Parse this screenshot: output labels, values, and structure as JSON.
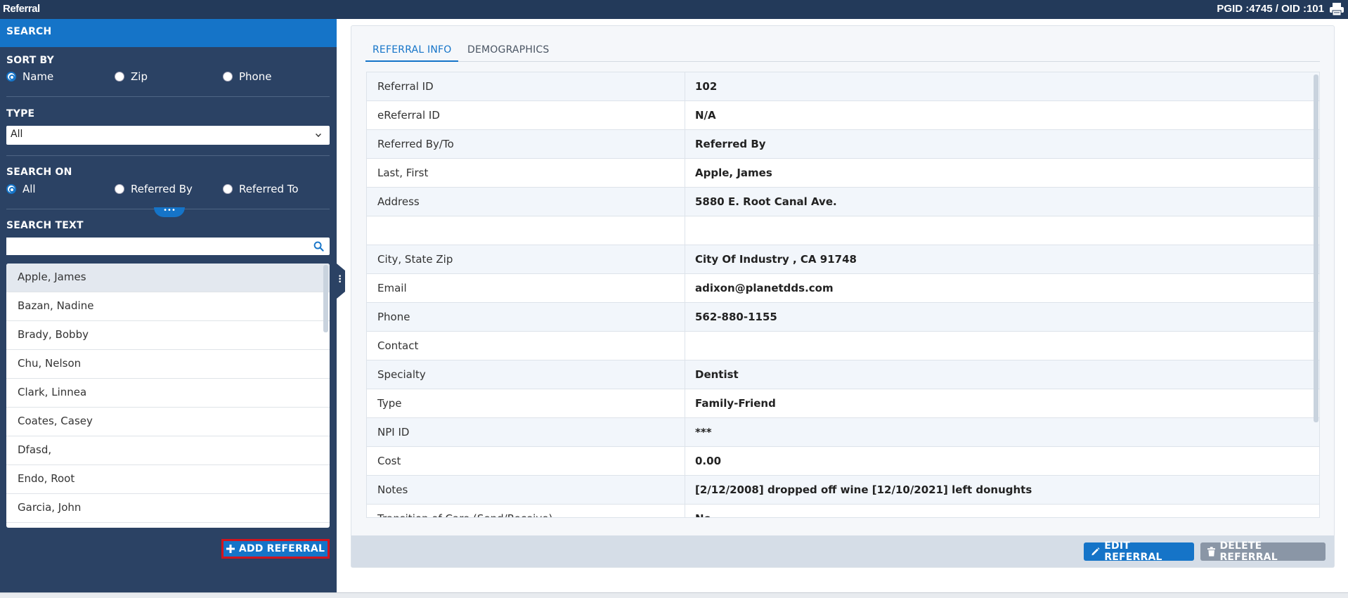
{
  "titlebar": {
    "title": "Referral",
    "ids": "PGID :4745  /  OID :101"
  },
  "sidebar": {
    "header": "SEARCH",
    "sort_by": {
      "label": "SORT BY",
      "options": [
        "Name",
        "Zip",
        "Phone"
      ],
      "selected": "Name"
    },
    "type": {
      "label": "TYPE",
      "value": "All"
    },
    "search_on": {
      "label": "SEARCH ON",
      "options": [
        "All",
        "Referred By",
        "Referred To"
      ],
      "selected": "All"
    },
    "search_text": {
      "label": "SEARCH TEXT",
      "value": "",
      "placeholder": ""
    },
    "names": [
      "Apple, James",
      "Bazan, Nadine",
      "Brady, Bobby",
      "Chu, Nelson",
      "Clark, Linnea",
      "Coates, Casey",
      "Dfasd,",
      "Endo, Root",
      "Garcia, John"
    ],
    "selected_name": "Apple, James",
    "add_button": "ADD REFERRAL"
  },
  "main": {
    "tabs": [
      {
        "label": "REFERRAL INFO",
        "active": true
      },
      {
        "label": "DEMOGRAPHICS",
        "active": false
      }
    ],
    "rows": [
      {
        "label": "Referral ID",
        "value": "102"
      },
      {
        "label": "eReferral ID",
        "value": "N/A"
      },
      {
        "label": "Referred By/To",
        "value": "Referred By"
      },
      {
        "label": "Last, First",
        "value": "Apple, James"
      },
      {
        "label": "Address",
        "value": "5880 E. Root Canal Ave."
      },
      {
        "label": "",
        "value": ""
      },
      {
        "label": "City, State Zip",
        "value": "City Of Industry , CA 91748"
      },
      {
        "label": "Email",
        "value": "adixon@planetdds.com"
      },
      {
        "label": "Phone",
        "value": "562-880-1155"
      },
      {
        "label": "Contact",
        "value": ""
      },
      {
        "label": "Specialty",
        "value": "Dentist"
      },
      {
        "label": "Type",
        "value": "Family-Friend"
      },
      {
        "label": "NPI ID",
        "value": "***"
      },
      {
        "label": "Cost",
        "value": "0.00"
      },
      {
        "label": "Notes",
        "value": "[2/12/2008] dropped off wine [12/10/2021] left donughts"
      },
      {
        "label": "Transition of Care (Send/Receive)",
        "value": "No"
      }
    ],
    "edit_button": "EDIT REFERRAL",
    "delete_button": "DELETE REFERRAL"
  },
  "colors": {
    "navy": "#2b4264",
    "accent": "#1574c8",
    "highlight": "#d2131d"
  }
}
